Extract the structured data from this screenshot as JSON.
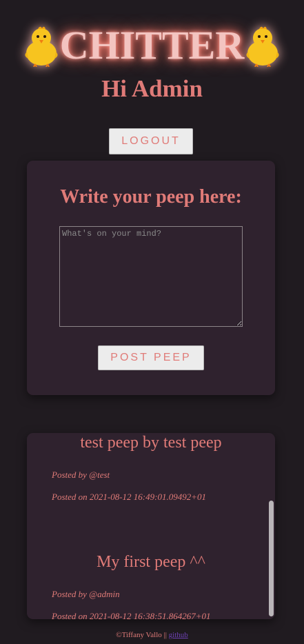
{
  "header": {
    "logo_text": "CHITTER",
    "logo_icon_left": "baby-chick-emoji",
    "logo_icon_right": "baby-chick-emoji",
    "greeting": "Hi Admin",
    "logout_label": "LOGOUT"
  },
  "compose": {
    "heading": "Write your peep here:",
    "placeholder": "What's on your mind?",
    "value": "",
    "post_label": "POST PEEP"
  },
  "feed": {
    "peeps": [
      {
        "title": "test peep by test peep",
        "posted_by": "Posted by @test",
        "posted_on": "Posted on 2021-08-12 16:49:01.09492+01"
      },
      {
        "title": "My first peep ^^",
        "posted_by": "Posted by @admin",
        "posted_on": "Posted on 2021-08-12 16:38:51.864267+01"
      }
    ]
  },
  "footer": {
    "copyright": "©Tiffany Vallo || ",
    "link_label": "github"
  },
  "colors": {
    "background": "#201b20",
    "card": "#2f222e",
    "accent": "#e07b78",
    "logo_text": "#f3c4c0",
    "button_bg": "#ececec",
    "link": "#6b3fb0"
  }
}
